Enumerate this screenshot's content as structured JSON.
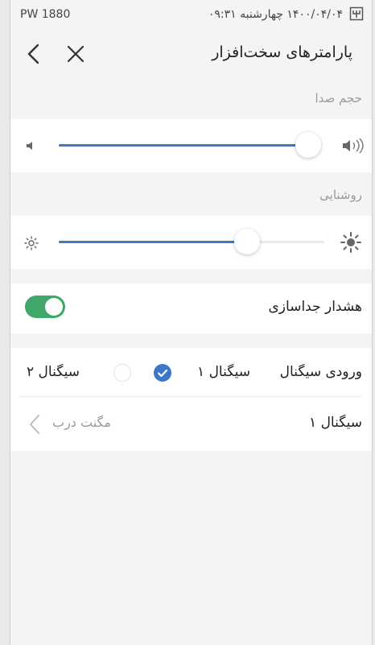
{
  "status_bar": {
    "device": "PW 1880",
    "date": "۱۴۰۰/۰۴/۰۴",
    "day": "چهارشنبه",
    "time": "۰۹:۳۱"
  },
  "header": {
    "title": "پارامترهای سخت‌افزار",
    "back_icon": "chevron-left-icon",
    "close_icon": "close-icon"
  },
  "volume": {
    "label": "حجم صدا",
    "level": 0.97,
    "min_icon": "volume-low-icon",
    "max_icon": "volume-high-icon"
  },
  "brightness": {
    "label": "روشنایی",
    "level": 0.71,
    "min_icon": "brightness-low-icon",
    "max_icon": "brightness-high-icon"
  },
  "separation_alarm": {
    "label": "هشدار جداسازی",
    "enabled": true
  },
  "signal_input": {
    "label": "ورودی سیگنال",
    "options": [
      {
        "label": "سیگنال ۱",
        "selected": true
      },
      {
        "label": "سیگنال ۲",
        "selected": false
      }
    ]
  },
  "signal_one": {
    "label": "سیگنال ۱",
    "value": "مگنت درب"
  },
  "colors": {
    "accent": "#3b78c8",
    "toggle_on": "#3fa76a",
    "background": "#f4f4f4",
    "card": "#ffffff"
  }
}
